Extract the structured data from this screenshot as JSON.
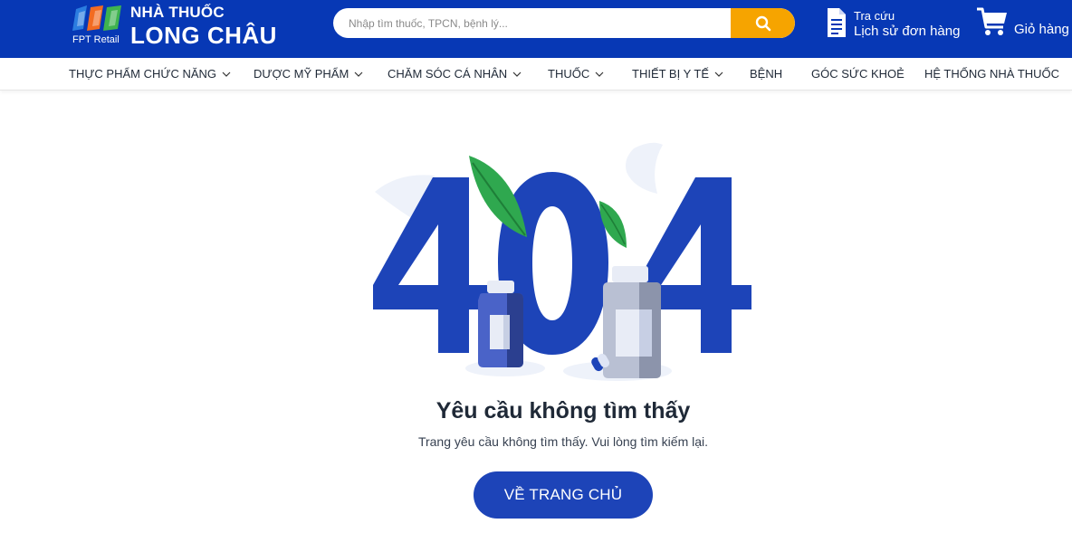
{
  "header": {
    "logo": {
      "brand_small": "FPT Retail",
      "line1": "NHÀ THUỐC",
      "line2": "LONG CHÂU"
    },
    "search": {
      "placeholder": "Nhập tìm thuốc, TPCN, bệnh lý...",
      "value": "",
      "button_icon": "search-icon"
    },
    "order_lookup": {
      "line1": "Tra cứu",
      "line2": "Lịch sử đơn hàng",
      "icon": "document-icon"
    },
    "cart": {
      "label": "Giỏ hàng",
      "icon": "cart-icon"
    }
  },
  "nav": {
    "items": [
      {
        "label": "THỰC PHẨM CHỨC NĂNG",
        "dropdown": true
      },
      {
        "label": "DƯỢC MỸ PHẨM",
        "dropdown": true
      },
      {
        "label": "CHĂM SÓC CÁ NHÂN",
        "dropdown": true
      },
      {
        "label": "THUỐC",
        "dropdown": true
      },
      {
        "label": "THIẾT BỊ Y TẾ",
        "dropdown": true
      },
      {
        "label": "BỆNH",
        "dropdown": false
      },
      {
        "label": "GÓC SỨC KHOẺ",
        "dropdown": false
      },
      {
        "label": "HỆ THỐNG NHÀ THUỐC",
        "dropdown": false
      }
    ]
  },
  "error": {
    "code": "404",
    "title": "Yêu cầu không tìm thấy",
    "message": "Trang yêu cầu không tìm thấy. Vui lòng tìm kiếm lại.",
    "home_button": "VỀ TRANG CHỦ"
  },
  "colors": {
    "header_bg": "#0738b5",
    "search_button": "#f6a400",
    "primary_blue": "#1d44b8",
    "leaf_green": "#2fa84f"
  }
}
